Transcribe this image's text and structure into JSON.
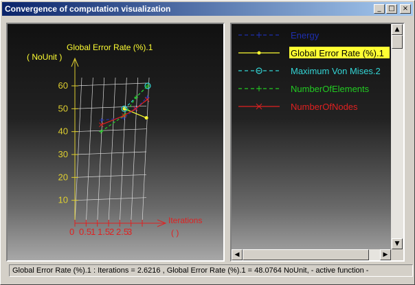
{
  "window": {
    "title": "Convergence of computation visualization",
    "minimize": "_",
    "maximize": "□",
    "close": "×"
  },
  "chart": {
    "ylabel": "Global Error Rate (%).1",
    "yunit": "( NoUnit )",
    "xlabel": "Iterations",
    "xunit": "(  )",
    "yticks": [
      "10",
      "20",
      "30",
      "40",
      "50",
      "60"
    ],
    "xticks": [
      "0",
      "0.5",
      "1",
      "1.5",
      "2",
      "2.5",
      "3"
    ]
  },
  "legend": {
    "items": [
      {
        "label": "Energy",
        "color": "#1f2fb0",
        "marker": "plus"
      },
      {
        "label": "Global Error Rate (%).1",
        "color": "#ffff33",
        "marker": "dot",
        "highlight": true
      },
      {
        "label": "Maximum Von Mises.2",
        "color": "#33d5d5",
        "marker": "circle"
      },
      {
        "label": "NumberOfElements",
        "color": "#22cc22",
        "marker": "plus"
      },
      {
        "label": "NumberOfNodes",
        "color": "#e02020",
        "marker": "cross"
      }
    ]
  },
  "chart_data": {
    "type": "line",
    "x": [
      1,
      2,
      2.5,
      3
    ],
    "ylim": [
      0,
      60
    ],
    "xlim": [
      0,
      3
    ],
    "series": [
      {
        "name": "Energy",
        "x": [
          1,
          2,
          2.5,
          3
        ],
        "values": [
          45,
          46,
          50,
          55
        ]
      },
      {
        "name": "Global Error Rate (%).1",
        "x": [
          2,
          3
        ],
        "values": [
          50,
          46
        ]
      },
      {
        "name": "Maximum Von Mises.2",
        "x": [
          2,
          3
        ],
        "values": [
          50,
          60
        ]
      },
      {
        "name": "NumberOfElements",
        "x": [
          1,
          2,
          2.5,
          3
        ],
        "values": [
          40,
          47,
          55,
          60
        ]
      },
      {
        "name": "NumberOfNodes",
        "x": [
          1,
          2,
          2.5,
          3
        ],
        "values": [
          43,
          47,
          50,
          54
        ]
      }
    ],
    "grid": true
  },
  "status": {
    "text": "Global Error Rate (%).1 : Iterations = 2.6216  , Global Error Rate (%).1 = 48.0764 NoUnit,  - active function -"
  }
}
